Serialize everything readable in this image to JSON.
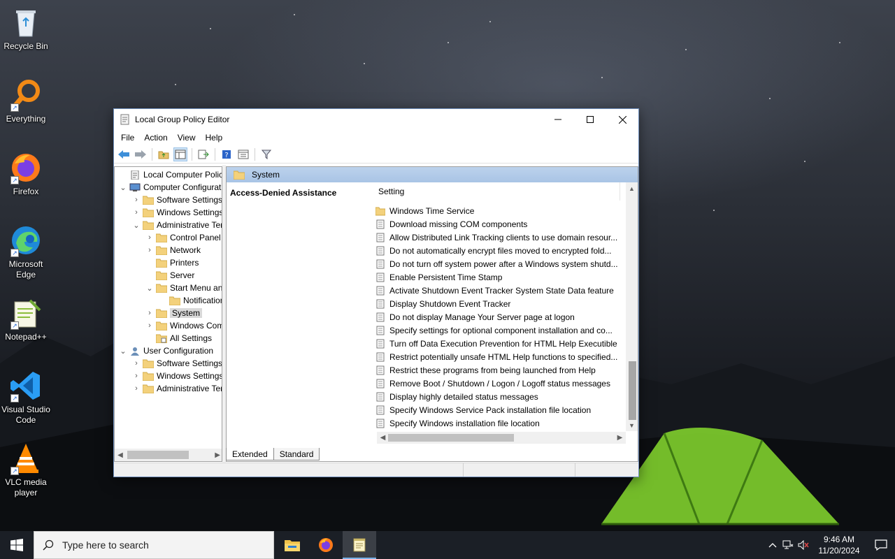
{
  "desktop": {
    "icons": [
      {
        "label": "Recycle Bin",
        "icon": "recycle-bin-icon"
      },
      {
        "label": "Everything",
        "icon": "everything-icon"
      },
      {
        "label": "Firefox",
        "icon": "firefox-icon"
      },
      {
        "label": "Microsoft Edge",
        "icon": "edge-icon"
      },
      {
        "label": "Notepad++",
        "icon": "notepadpp-icon"
      },
      {
        "label": "Visual Studio Code",
        "icon": "vscode-icon"
      },
      {
        "label": "VLC media player",
        "icon": "vlc-icon"
      }
    ]
  },
  "window": {
    "title": "Local Group Policy Editor",
    "menu": [
      "File",
      "Action",
      "View",
      "Help"
    ],
    "toolbar": [
      "back-icon",
      "forward-icon",
      "up-folder-icon",
      "show-hide-tree-icon",
      "export-list-icon",
      "help-icon",
      "properties-icon",
      "filter-icon"
    ]
  },
  "tree": {
    "items": [
      {
        "label": "Local Computer Policy",
        "depth": 0,
        "expander": "",
        "icon": "policy-root-icon"
      },
      {
        "label": "Computer Configuration",
        "depth": 0,
        "expander": "open",
        "icon": "computer-icon"
      },
      {
        "label": "Software Settings",
        "depth": 1,
        "expander": "closed",
        "icon": "folder-icon"
      },
      {
        "label": "Windows Settings",
        "depth": 1,
        "expander": "closed",
        "icon": "folder-icon"
      },
      {
        "label": "Administrative Templates",
        "depth": 1,
        "expander": "open",
        "icon": "folder-icon"
      },
      {
        "label": "Control Panel",
        "depth": 2,
        "expander": "closed",
        "icon": "folder-icon"
      },
      {
        "label": "Network",
        "depth": 2,
        "expander": "closed",
        "icon": "folder-icon"
      },
      {
        "label": "Printers",
        "depth": 2,
        "expander": "",
        "icon": "folder-icon"
      },
      {
        "label": "Server",
        "depth": 2,
        "expander": "",
        "icon": "folder-icon"
      },
      {
        "label": "Start Menu and Taskbar",
        "depth": 2,
        "expander": "open",
        "icon": "folder-icon"
      },
      {
        "label": "Notifications",
        "depth": 3,
        "expander": "",
        "icon": "folder-icon"
      },
      {
        "label": "System",
        "depth": 2,
        "expander": "closed",
        "icon": "folder-icon",
        "selected": true
      },
      {
        "label": "Windows Components",
        "depth": 2,
        "expander": "closed",
        "icon": "folder-icon"
      },
      {
        "label": "All Settings",
        "depth": 2,
        "expander": "",
        "icon": "all-settings-icon"
      },
      {
        "label": "User Configuration",
        "depth": 0,
        "expander": "open",
        "icon": "user-icon"
      },
      {
        "label": "Software Settings",
        "depth": 1,
        "expander": "closed",
        "icon": "folder-icon"
      },
      {
        "label": "Windows Settings",
        "depth": 1,
        "expander": "closed",
        "icon": "folder-icon"
      },
      {
        "label": "Administrative Templates",
        "depth": 1,
        "expander": "closed",
        "icon": "folder-icon"
      }
    ]
  },
  "right": {
    "header": "System",
    "description_title": "Access-Denied Assistance",
    "column_header": "Setting",
    "rows": [
      {
        "label": "Windows Time Service",
        "icon": "folder-icon"
      },
      {
        "label": "Download missing COM components",
        "icon": "policy-setting-icon"
      },
      {
        "label": "Allow Distributed Link Tracking clients to use domain resour...",
        "icon": "policy-setting-icon"
      },
      {
        "label": "Do not automatically encrypt files moved to encrypted fold...",
        "icon": "policy-setting-icon"
      },
      {
        "label": "Do not turn off system power after a Windows system shutd...",
        "icon": "policy-setting-icon"
      },
      {
        "label": "Enable Persistent Time Stamp",
        "icon": "policy-setting-icon"
      },
      {
        "label": "Activate Shutdown Event Tracker System State Data feature",
        "icon": "policy-setting-icon"
      },
      {
        "label": "Display Shutdown Event Tracker",
        "icon": "policy-setting-icon"
      },
      {
        "label": "Do not display Manage Your Server page at logon",
        "icon": "policy-setting-icon"
      },
      {
        "label": "Specify settings for optional component installation and co...",
        "icon": "policy-setting-icon"
      },
      {
        "label": "Turn off Data Execution Prevention for HTML Help Executible",
        "icon": "policy-setting-icon"
      },
      {
        "label": "Restrict potentially unsafe HTML Help functions to specified...",
        "icon": "policy-setting-icon"
      },
      {
        "label": "Restrict these programs from being launched from Help",
        "icon": "policy-setting-icon"
      },
      {
        "label": "Remove Boot / Shutdown / Logon / Logoff status messages",
        "icon": "policy-setting-icon"
      },
      {
        "label": "Display highly detailed status messages",
        "icon": "policy-setting-icon"
      },
      {
        "label": "Specify Windows Service Pack installation file location",
        "icon": "policy-setting-icon"
      },
      {
        "label": "Specify Windows installation file location",
        "icon": "policy-setting-icon"
      }
    ],
    "tabs": [
      "Extended",
      "Standard"
    ],
    "active_tab": "Extended"
  },
  "taskbar": {
    "search_placeholder": "Type here to search",
    "apps": [
      "file-explorer-icon",
      "firefox-icon",
      "notepad-icon"
    ],
    "active_app": "notepad-icon",
    "time": "9:46 AM",
    "date": "11/20/2024"
  },
  "colors": {
    "header_blue": "#a9c4e5",
    "accent": "#7ab1e8",
    "taskbar": "#1b1f26"
  }
}
